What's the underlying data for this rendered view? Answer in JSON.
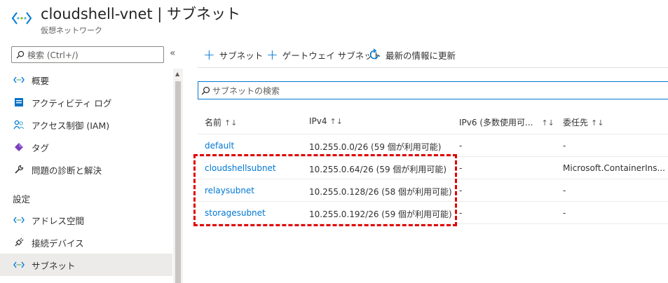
{
  "header": {
    "title": "cloudshell-vnet | サブネット",
    "subtitle": "仮想ネットワーク"
  },
  "sidebar": {
    "search_placeholder": "検索 (Ctrl+/)",
    "collapse": "«",
    "section_label": "設定",
    "items": [
      {
        "label": "概要",
        "icon": "vnet-icon"
      },
      {
        "label": "アクティビティ ログ",
        "icon": "activity-log-icon"
      },
      {
        "label": "アクセス制御 (IAM)",
        "icon": "iam-icon"
      },
      {
        "label": "タグ",
        "icon": "tag-icon"
      },
      {
        "label": "問題の診断と解決",
        "icon": "wrench-icon"
      },
      {
        "label": "アドレス空間",
        "icon": "vnet-icon"
      },
      {
        "label": "接続デバイス",
        "icon": "plug-icon"
      },
      {
        "label": "サブネット",
        "icon": "vnet-icon",
        "active": true
      }
    ]
  },
  "toolbar": {
    "add_subnet": "サブネット",
    "add_gateway_subnet": "ゲートウェイ サブネット",
    "refresh": "最新の情報に更新"
  },
  "filter": {
    "placeholder": "サブネットの検索"
  },
  "table": {
    "columns": [
      "名前",
      "IPv4",
      "IPv6 (多数使用可...",
      "委任先"
    ],
    "rows": [
      {
        "name": "default",
        "ipv4": "10.255.0.0/26 (59 個が利用可能)",
        "ipv6": "-",
        "delegation": "-"
      },
      {
        "name": "cloudshellsubnet",
        "ipv4": "10.255.0.64/26 (59 個が利用可能)",
        "ipv6": "-",
        "delegation": "Microsoft.ContainerIns..."
      },
      {
        "name": "relaysubnet",
        "ipv4": "10.255.0.128/26 (58 個が利用可能)",
        "ipv6": "-",
        "delegation": "-"
      },
      {
        "name": "storagesubnet",
        "ipv4": "10.255.0.192/26 (59 個が利用可能)",
        "ipv6": "-",
        "delegation": "-"
      }
    ]
  },
  "colors": {
    "accent": "#0078d4",
    "highlight": "#e00000",
    "selected_bg": "#edebe9"
  }
}
